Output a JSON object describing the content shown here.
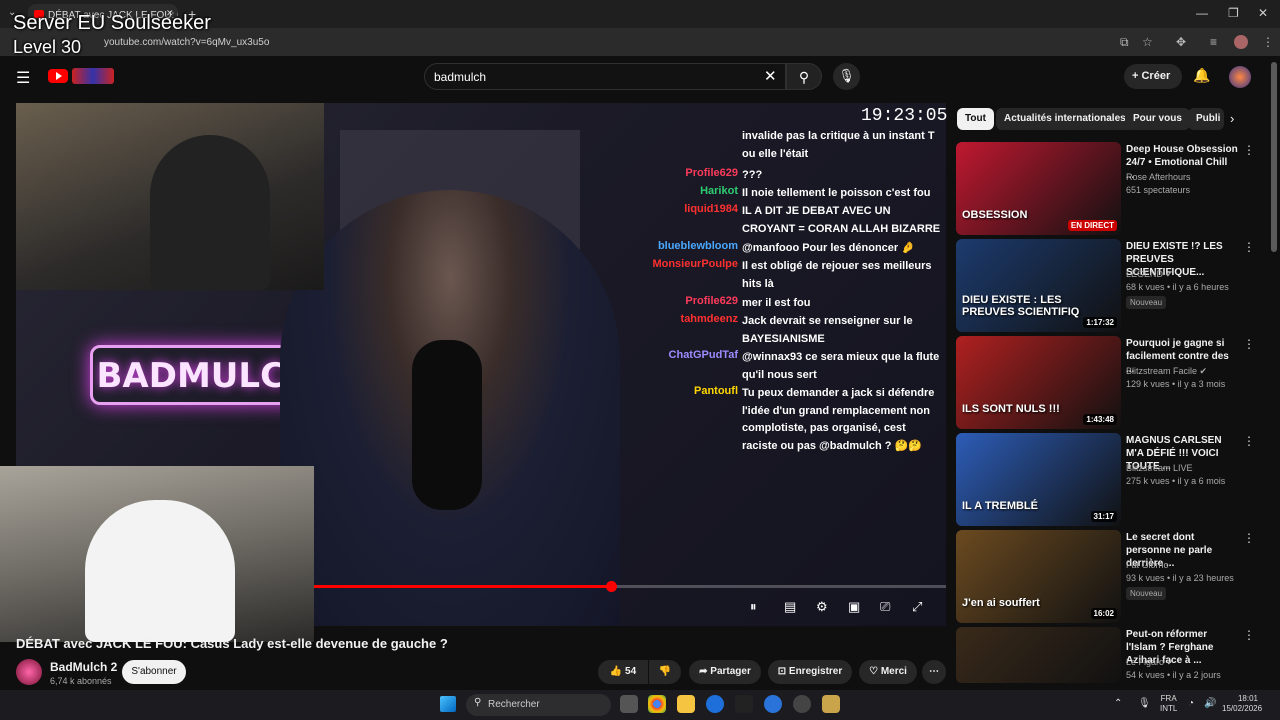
{
  "browser": {
    "tab_title": "DÉBAT avec JACK LE FOU: Casus",
    "url": "youtube.com/watch?v=6qMv_ux3u5o",
    "new_tab": "+",
    "minimize": "—",
    "restore": "❐",
    "close": "✕"
  },
  "overlay": {
    "line1": "Server EU Soulseeker",
    "line2": "Level 30"
  },
  "header": {
    "search_value": "badmulch",
    "create_label": "Créer"
  },
  "video": {
    "clock": "19:23:05",
    "neon_text": "BADMULCH",
    "progress": 0.47,
    "title": "DÉBAT avec JACK LE FOU: Casus Lady est-elle devenue de gauche ?",
    "channel": "BadMulch 2",
    "subscribers": "6,74 k abonnés",
    "subscribe_label": "S'abonner",
    "likes": "54",
    "share_label": "Partager",
    "save_label": "Enregistrer",
    "thanks_label": "Merci"
  },
  "chat": [
    {
      "name": "",
      "name_color": "#ffffff",
      "text": "invalide pas la critique à un instant T ou elle l'était"
    },
    {
      "name": "Profile629",
      "name_color": "#ff3b5c",
      "text": "???"
    },
    {
      "name": "Harikot",
      "name_color": "#2ecc71",
      "text": "Il noie tellement le poisson c'est fou"
    },
    {
      "name": "liquid1984",
      "name_color": "#ff3030",
      "text": "IL A DIT JE DEBAT AVEC UN CROYANT = CORAN ALLAH BIZARRE"
    },
    {
      "name": "blueblewbloom",
      "name_color": "#4aa8ff",
      "text": "@manfooo Pour les dénoncer 🤌"
    },
    {
      "name": "MonsieurPoulpe",
      "name_color": "#ff3030",
      "text": "Il est obligé de rejouer ses meilleurs hits là"
    },
    {
      "name": "Profile629",
      "name_color": "#ff3b5c",
      "text": "mer il est fou"
    },
    {
      "name": "tahmdeenz",
      "name_color": "#ff3030",
      "text": "Jack devrait se renseigner sur le BAYESIANISME"
    },
    {
      "name": "ChatGPudTaf",
      "name_color": "#9b8cff",
      "text": "@winnax93 ce sera mieux que la flute qu'il nous sert"
    },
    {
      "name": "Pantoufl",
      "name_color": "#ffd700",
      "text": "Tu peux demander a jack si défendre l'idée d'un grand remplacement non complotiste, pas organisé, cest raciste ou pas @badmulch ? 🤔🤔"
    }
  ],
  "chips": [
    "Tout",
    "Actualités internationales",
    "Pour vous",
    "Publi"
  ],
  "recommendations": [
    {
      "title": "Deep House Obsession 24/7 • Emotional Chill ...",
      "channel": "Rose Afterhours",
      "meta": "651 spectateurs",
      "badge": "",
      "duration": "EN DIRECT",
      "thumb_text": "OBSESSION",
      "thumb_color": "#c01830"
    },
    {
      "title": "DIEU EXISTE !? LES PREUVES SCIENTIFIQUE...",
      "channel": "LEGEND ✔",
      "meta": "68 k vues • il y a 6 heures",
      "badge": "Nouveau",
      "duration": "1:17:32",
      "thumb_text": "DIEU EXISTE : LES PREUVES SCIENTIFIQ",
      "thumb_color": "#1c3b6e"
    },
    {
      "title": "Pourquoi je gagne si facilement contre des ...",
      "channel": "Blitzstream Facile ✔",
      "meta": "129 k vues • il y a 3 mois",
      "badge": "",
      "duration": "1:43:48",
      "thumb_text": "ILS SONT NULS !!!",
      "thumb_color": "#b02020"
    },
    {
      "title": "MAGNUS CARLSEN M'A DÉFIÉ !!! VOICI TOUTE ...",
      "channel": "Blitzstream LIVE",
      "meta": "275 k vues • il y a 6 mois",
      "badge": "",
      "duration": "31:17",
      "thumb_text": "IL A TREMBLÉ",
      "thumb_color": "#2c5db8"
    },
    {
      "title": "Le secret dont personne ne parle derrière ...",
      "channel": "Fat Giorno",
      "meta": "93 k vues • il y a 23 heures",
      "badge": "Nouveau",
      "duration": "16:02",
      "thumb_text": "J'en ai souffert",
      "thumb_color": "#6b4a20"
    },
    {
      "title": "Peut-on réformer l'Islam ? Ferghane Azihari face à ...",
      "channel": "Le Figaro ✔",
      "meta": "54 k vues • il y a 2 jours",
      "badge": "",
      "duration": "",
      "thumb_text": "",
      "thumb_color": "#3a2a1a"
    }
  ],
  "taskbar": {
    "search_placeholder": "Rechercher",
    "lang_line1": "FRA",
    "lang_line2": "INTL",
    "time": "18:01",
    "date": "15/02/2026"
  }
}
